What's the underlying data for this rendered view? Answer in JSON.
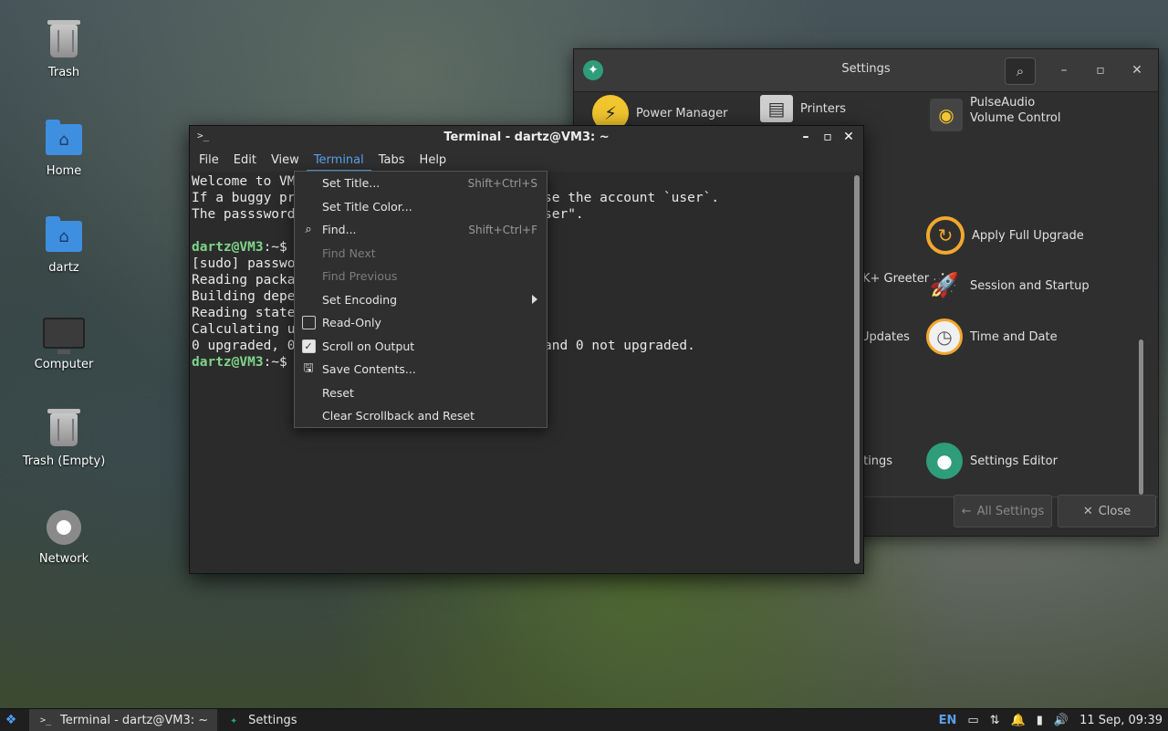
{
  "desktop": {
    "icons": [
      {
        "label": "Trash"
      },
      {
        "label": "Home"
      },
      {
        "label": "dartz"
      },
      {
        "label": "Computer"
      },
      {
        "label": "Trash (Empty)"
      },
      {
        "label": "Network"
      }
    ]
  },
  "settings": {
    "title": "Settings",
    "items": [
      {
        "label": "Power Manager"
      },
      {
        "label": "Printers"
      },
      {
        "label": "PulseAudio Volume Control"
      },
      {
        "label": "Apply Full Upgrade"
      },
      {
        "label": "Session and Startup"
      },
      {
        "label": "Time and Date"
      },
      {
        "label": "Settings Editor"
      },
      {
        "label": "r"
      },
      {
        "label": "K+ Greeter"
      },
      {
        "label": "Updates"
      },
      {
        "label": "ttings"
      }
    ],
    "footer": {
      "all_settings": "All Settings",
      "close": "Close"
    }
  },
  "terminal": {
    "title": "Terminal - dartz@VM3: ~",
    "menu": [
      "File",
      "Edit",
      "View",
      "Terminal",
      "Tabs",
      "Help"
    ],
    "lines": [
      "Welcome to VM",
      "If a buggy pr",
      "The passsword",
      "",
      "",
      "[sudo] passwo",
      "Reading packa",
      "Building depe",
      "Reading state",
      "Calculating u",
      "0 upgraded, 0",
      ""
    ],
    "right_text": {
      "l1": "se the account `user`.",
      "l2": "ser\".",
      "l10": "and 0 not upgraded."
    },
    "prompt": "dartz@VM3",
    "prompt_suffix": ":~$"
  },
  "terminal_menu": {
    "items": [
      {
        "label": "Set Title...",
        "shortcut": "Shift+Ctrl+S"
      },
      {
        "label": "Set Title Color...",
        "shortcut": ""
      },
      {
        "label": "Find...",
        "shortcut": "Shift+Ctrl+F"
      },
      {
        "label": "Find Next",
        "shortcut": ""
      },
      {
        "label": "Find Previous",
        "shortcut": ""
      },
      {
        "label": "Set Encoding",
        "shortcut": ""
      },
      {
        "label": "Read-Only",
        "shortcut": ""
      },
      {
        "label": "Scroll on Output",
        "shortcut": ""
      },
      {
        "label": "Save Contents...",
        "shortcut": ""
      },
      {
        "label": "Reset",
        "shortcut": ""
      },
      {
        "label": "Clear Scrollback and Reset",
        "shortcut": ""
      }
    ]
  },
  "taskbar": {
    "tasks": [
      {
        "label": "Terminal - dartz@VM3: ~"
      },
      {
        "label": "Settings"
      }
    ],
    "lang": "EN",
    "clock": "11 Sep, 09:39"
  },
  "colors": {
    "accent": "#5aa0e8",
    "prompt": "#7fd68a"
  }
}
